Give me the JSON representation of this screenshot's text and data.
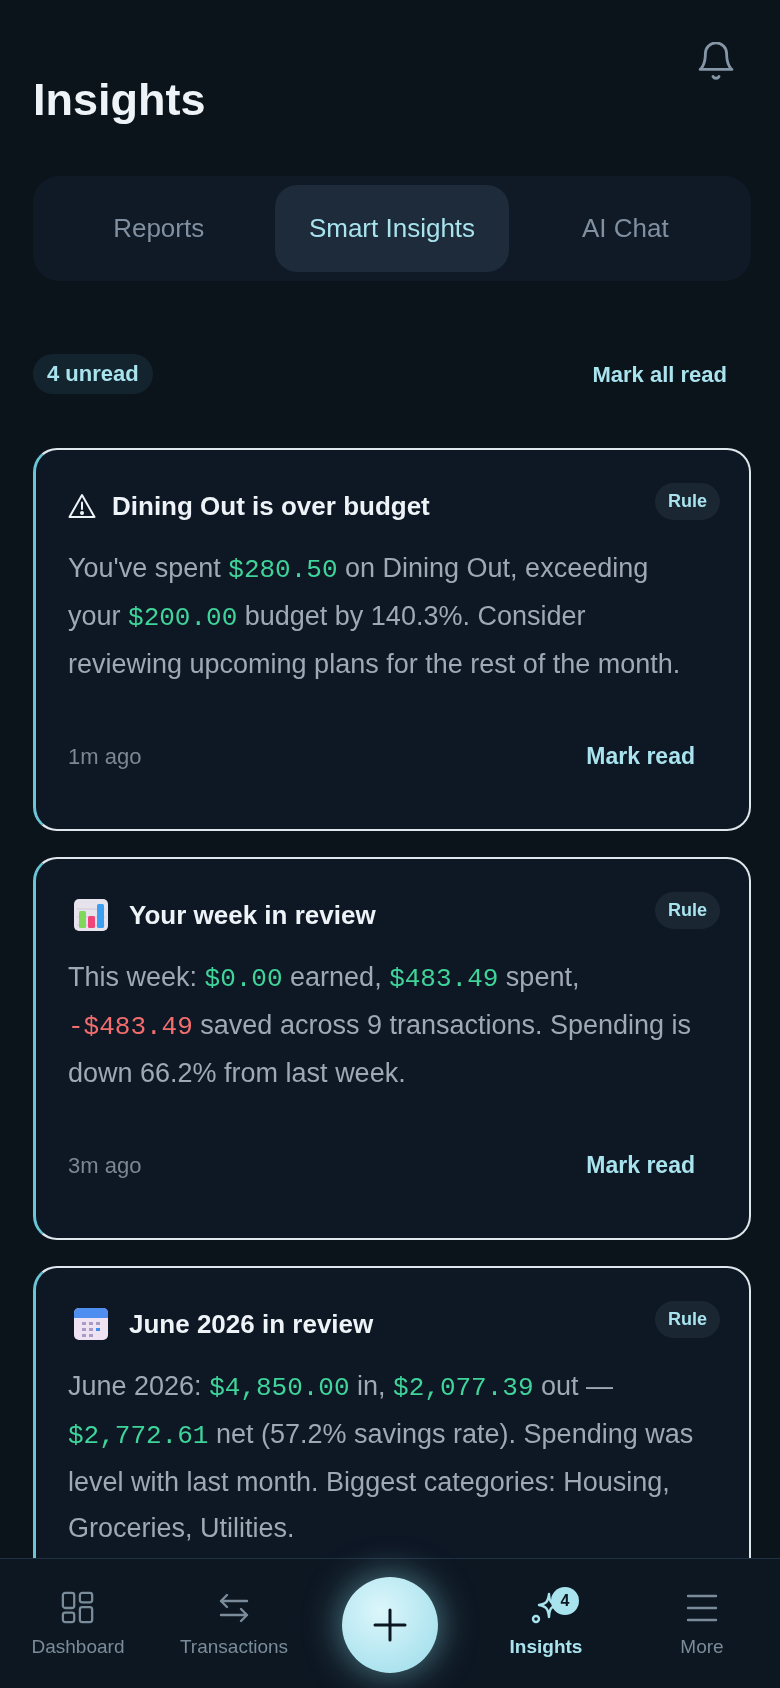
{
  "header": {
    "title": "Insights"
  },
  "tabs": [
    {
      "label": "Reports",
      "selected": false
    },
    {
      "label": "Smart Insights",
      "selected": true
    },
    {
      "label": "AI Chat",
      "selected": false
    }
  ],
  "toolbar": {
    "unread_badge": "4 unread",
    "action": "Mark all read"
  },
  "insights": [
    {
      "kind": "warning",
      "unread": true,
      "title": "Dining Out is over budget",
      "tag": "Rule",
      "body": [
        {
          "kind": "plain",
          "text": "You've spent "
        },
        {
          "kind": "amount",
          "text": "$280.50"
        },
        {
          "kind": "plain",
          "text": " on Dining Out, exceeding your "
        },
        {
          "kind": "amount",
          "text": "$200.00"
        },
        {
          "kind": "plain",
          "text": " budget by 140.3%. Consider reviewing upcoming plans for the rest of the month."
        }
      ],
      "time": "1m ago",
      "action": "Mark read"
    },
    {
      "kind": "chart",
      "unread": true,
      "title": "Your week in review",
      "tag": "Rule",
      "body": [
        {
          "kind": "plain",
          "text": "This week: "
        },
        {
          "kind": "amount",
          "text": "$0.00"
        },
        {
          "kind": "plain",
          "text": " earned, "
        },
        {
          "kind": "amount",
          "text": "$483.49"
        },
        {
          "kind": "plain",
          "text": " spent, "
        },
        {
          "kind": "negative",
          "text": "-$483.49"
        },
        {
          "kind": "plain",
          "text": " saved across 9 transactions. Spending is down 66.2% from last week."
        }
      ],
      "time": "3m ago",
      "action": "Mark read"
    },
    {
      "kind": "calendar",
      "unread": true,
      "title": "June 2026 in review",
      "tag": "Rule",
      "body": [
        {
          "kind": "plain",
          "text": "June 2026: "
        },
        {
          "kind": "amount",
          "text": "$4,850.00"
        },
        {
          "kind": "plain",
          "text": " in, "
        },
        {
          "kind": "amount",
          "text": "$2,077.39"
        },
        {
          "kind": "plain",
          "text": " out — "
        },
        {
          "kind": "amount",
          "text": "$2,772.61"
        },
        {
          "kind": "plain",
          "text": " net (57.2% savings rate). Spending was level with last month. Biggest categories: Housing, Groceries, Utilities."
        }
      ]
    }
  ],
  "bottom_nav": {
    "items": [
      {
        "kind": "dashboard",
        "label": "Dashboard",
        "selected": false
      },
      {
        "kind": "transfer",
        "label": "Transactions",
        "selected": false
      },
      {
        "kind": "add",
        "selected": false
      },
      {
        "kind": "sparkle",
        "label": "Insights",
        "selected": true,
        "badge": "4"
      },
      {
        "kind": "menu",
        "label": "More",
        "selected": false
      }
    ]
  }
}
